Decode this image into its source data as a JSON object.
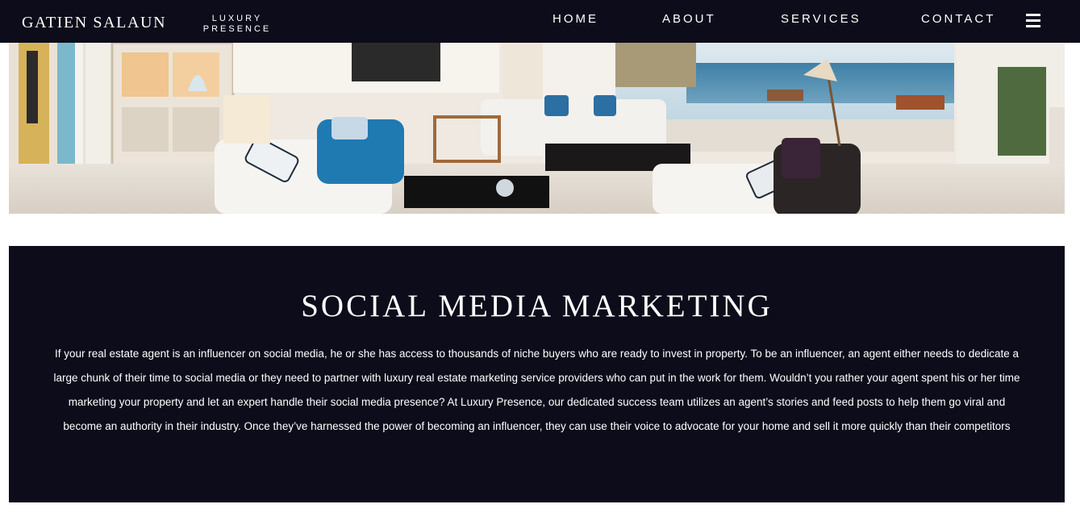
{
  "header": {
    "brand": "GATIEN SALAUN",
    "sublogo_line1": "LUXURY",
    "sublogo_line2": "PRESENCE",
    "nav": {
      "home": "HOME",
      "about": "ABOUT",
      "services": "SERVICES",
      "contact": "CONTACT"
    },
    "menu_icon": "hamburger-menu-icon"
  },
  "hero": {
    "image_subject": "luxury living room with sea view"
  },
  "section": {
    "title": "SOCIAL MEDIA MARKETING",
    "body": "If your real estate agent is an influencer on social media, he or she has access to thousands of niche buyers who are ready to invest in property. To be an influencer, an agent either needs to dedicate a large chunk of their time to social media or they need to partner with luxury real estate marketing service providers who can put in the work for them. Wouldn’t you rather your agent spent his or her time marketing your property and let an expert handle their social media presence? At Luxury Presence, our dedicated success team utilizes an agent’s stories and feed posts to help them go viral and become an authority in their industry. Once they’ve harnessed the power of becoming an influencer, they can use their voice to advocate for your home and sell it more quickly than their competitors"
  },
  "colors": {
    "navy": "#0d0c1a",
    "text": "#ffffff",
    "background": "#ffffff"
  }
}
